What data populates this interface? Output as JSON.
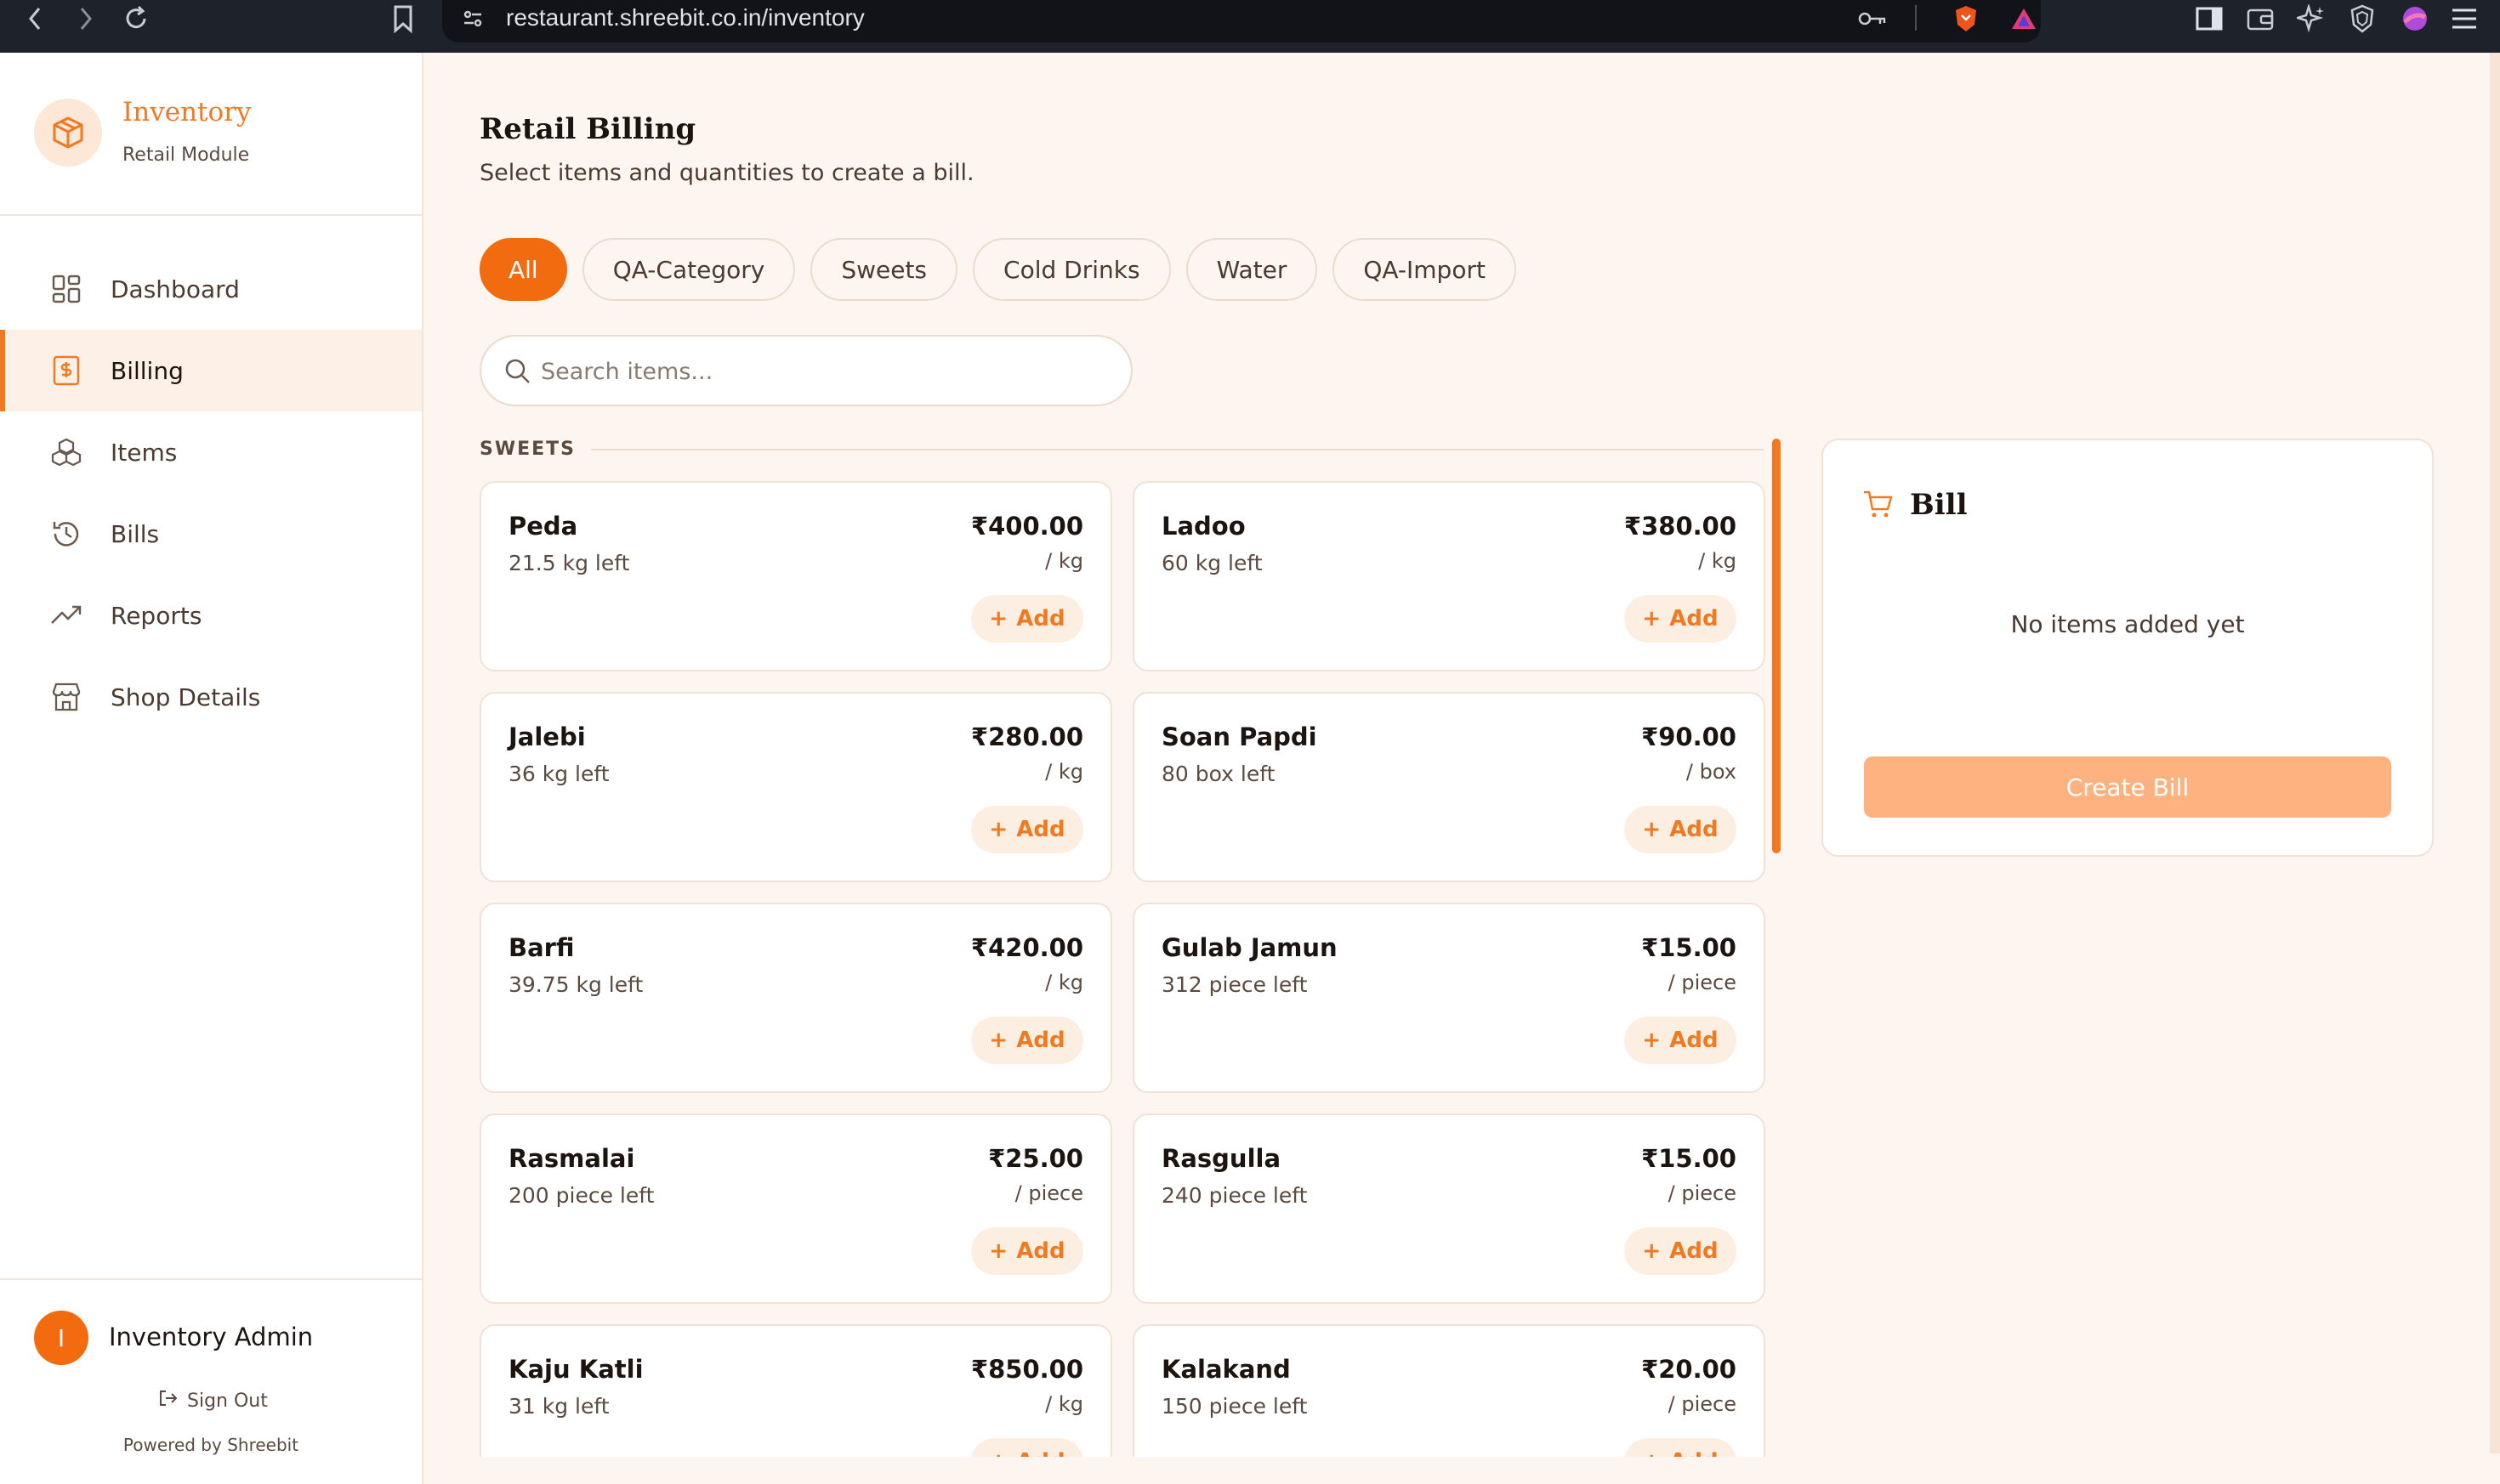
{
  "browser": {
    "url": "restaurant.shreebit.co.in/inventory"
  },
  "sidebar": {
    "brand_title": "Inventory",
    "brand_subtitle": "Retail Module",
    "items": [
      {
        "label": "Dashboard",
        "icon": "dashboard-grid-icon",
        "active": false
      },
      {
        "label": "Billing",
        "icon": "receipt-dollar-icon",
        "active": true
      },
      {
        "label": "Items",
        "icon": "boxes-icon",
        "active": false
      },
      {
        "label": "Bills",
        "icon": "history-icon",
        "active": false
      },
      {
        "label": "Reports",
        "icon": "trending-up-icon",
        "active": false
      },
      {
        "label": "Shop Details",
        "icon": "store-icon",
        "active": false
      }
    ],
    "user": {
      "initial": "I",
      "name": "Inventory Admin"
    },
    "sign_out": "Sign Out",
    "powered_by": "Powered by Shreebit"
  },
  "main": {
    "title": "Retail Billing",
    "subtitle": "Select items and quantities to create a bill.",
    "filters": [
      {
        "label": "All",
        "active": true
      },
      {
        "label": "QA-Category",
        "active": false
      },
      {
        "label": "Sweets",
        "active": false
      },
      {
        "label": "Cold Drinks",
        "active": false
      },
      {
        "label": "Water",
        "active": false
      },
      {
        "label": "QA-Import",
        "active": false
      }
    ],
    "search_placeholder": "Search items...",
    "section_title": "SWEETS",
    "add_label": "Add",
    "items": [
      {
        "name": "Peda",
        "stock": "21.5 kg left",
        "price": "₹400.00",
        "unit": "/ kg"
      },
      {
        "name": "Ladoo",
        "stock": "60 kg left",
        "price": "₹380.00",
        "unit": "/ kg"
      },
      {
        "name": "Jalebi",
        "stock": "36 kg left",
        "price": "₹280.00",
        "unit": "/ kg"
      },
      {
        "name": "Soan Papdi",
        "stock": "80 box left",
        "price": "₹90.00",
        "unit": "/ box"
      },
      {
        "name": "Barfi",
        "stock": "39.75 kg left",
        "price": "₹420.00",
        "unit": "/ kg"
      },
      {
        "name": "Gulab Jamun",
        "stock": "312 piece left",
        "price": "₹15.00",
        "unit": "/ piece"
      },
      {
        "name": "Rasmalai",
        "stock": "200 piece left",
        "price": "₹25.00",
        "unit": "/ piece"
      },
      {
        "name": "Rasgulla",
        "stock": "240 piece left",
        "price": "₹15.00",
        "unit": "/ piece"
      },
      {
        "name": "Kaju Katli",
        "stock": "31 kg left",
        "price": "₹850.00",
        "unit": "/ kg"
      },
      {
        "name": "Kalakand",
        "stock": "150 piece left",
        "price": "₹20.00",
        "unit": "/ piece"
      }
    ]
  },
  "bill": {
    "title": "Bill",
    "empty_text": "No items added yet",
    "create_label": "Create Bill"
  },
  "colors": {
    "accent": "#f26b0f",
    "accent_light": "#fdeee2",
    "background": "#fdf6f0",
    "create_disabled": "#fdb27f"
  }
}
